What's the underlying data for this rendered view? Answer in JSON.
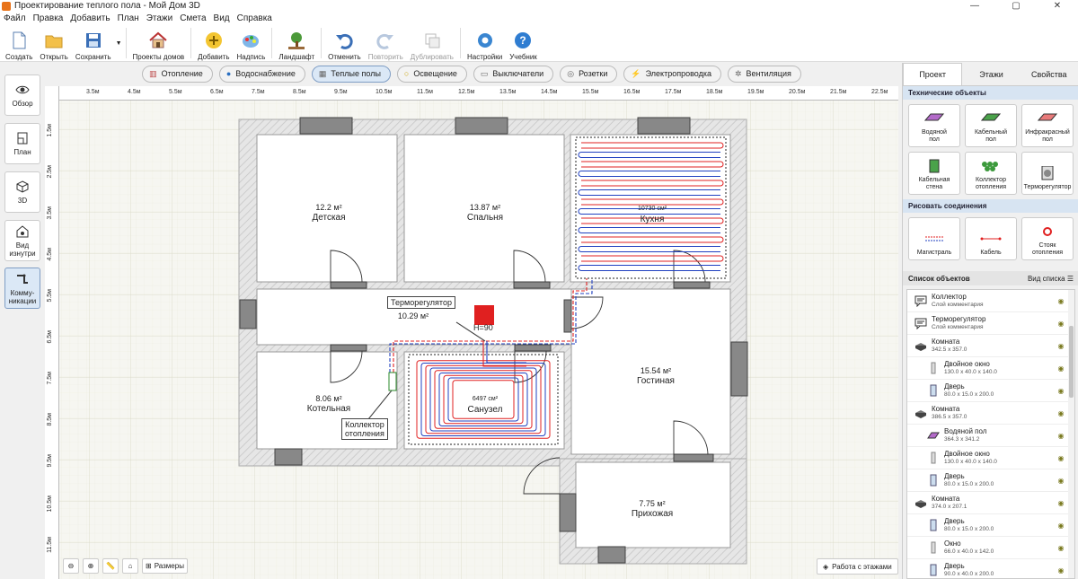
{
  "window": {
    "title": "Проектирование теплого пола - Мой Дом 3D",
    "controls": [
      "—",
      "▢",
      "✕"
    ]
  },
  "menu": [
    "Файл",
    "Правка",
    "Добавить",
    "План",
    "Этажи",
    "Смета",
    "Вид",
    "Справка"
  ],
  "toolbar": {
    "create": "Создать",
    "open": "Открыть",
    "save": "Сохранить",
    "house_projects": "Проекты домов",
    "add": "Добавить",
    "label": "Надпись",
    "landscape": "Ландшафт",
    "undo": "Отменить",
    "redo": "Повторить",
    "duplicate": "Дублировать",
    "settings": "Настройки",
    "tutorial": "Учебник"
  },
  "categories": [
    {
      "label": "Отопление",
      "icon": "radiator-icon"
    },
    {
      "label": "Водоснабжение",
      "icon": "water-drop-icon"
    },
    {
      "label": "Теплые полы",
      "icon": "floor-heating-icon",
      "active": true
    },
    {
      "label": "Освещение",
      "icon": "bulb-icon"
    },
    {
      "label": "Выключатели",
      "icon": "switch-icon"
    },
    {
      "label": "Розетки",
      "icon": "socket-icon"
    },
    {
      "label": "Электропроводка",
      "icon": "lightning-icon"
    },
    {
      "label": "Вентиляция",
      "icon": "fan-icon"
    }
  ],
  "leftbar": {
    "overview": "Обзор",
    "plan": "План",
    "view3d": "3D",
    "inside_1": "Вид",
    "inside_2": "изнутри",
    "comm_1": "Комму-",
    "comm_2": "никации"
  },
  "ruler": {
    "top": [
      "3.5м",
      "4.5м",
      "5.5м",
      "6.5м",
      "7.5м",
      "8.5м",
      "9.5м",
      "10.5м",
      "11.5м",
      "12.5м",
      "13.5м",
      "14.5м",
      "15.5м",
      "16.5м",
      "17.5м",
      "18.5м",
      "19.5м",
      "20.5м",
      "21.5м",
      "22.5м"
    ],
    "left": [
      "1.5м",
      "2.5м",
      "3.5м",
      "4.5м",
      "5.5м",
      "6.5м",
      "7.5м",
      "8.5м",
      "9.5м",
      "10.5м",
      "11.5м"
    ]
  },
  "rooms": {
    "kids": {
      "name": "Детская",
      "area": "12.2 м²"
    },
    "bedroom": {
      "name": "Спальня",
      "area": "13.87 м²"
    },
    "kitchen": {
      "name": "Кухня",
      "floor_size": "10730 см²"
    },
    "hall": {
      "area": "10.29 м²"
    },
    "boiler": {
      "name": "Котельная",
      "area": "8.06 м²"
    },
    "bathroom": {
      "name": "Санузел",
      "floor_size": "6497 см²"
    },
    "living": {
      "name": "Гостиная",
      "area": "15.54 м²"
    },
    "entry": {
      "name": "Прихожая",
      "area": "7.75 м²"
    }
  },
  "callouts": {
    "thermostat": "Терморегулятор",
    "collector_1": "Коллектор",
    "collector_2": "отопления",
    "height": "H=90"
  },
  "bottom": {
    "sizes": "Размеры",
    "floors": "Работа с этажами"
  },
  "right": {
    "tabs": [
      "Проект",
      "Этажи",
      "Свойства"
    ],
    "tech_header": "Технические объекты",
    "tech_tiles": [
      {
        "l1": "Водяной",
        "l2": "пол"
      },
      {
        "l1": "Кабельный",
        "l2": "пол"
      },
      {
        "l1": "Инфракрасный",
        "l2": "пол"
      },
      {
        "l1": "Кабельная",
        "l2": "стена"
      },
      {
        "l1": "Коллектор",
        "l2": "отопления"
      },
      {
        "l1": "Терморегулятор",
        "l2": ""
      }
    ],
    "conn_header": "Рисовать соединения",
    "conn_tiles": [
      {
        "l1": "Магистраль",
        "l2": ""
      },
      {
        "l1": "Кабель",
        "l2": ""
      },
      {
        "l1": "Стояк",
        "l2": "отопления"
      }
    ],
    "list_header": "Список объектов",
    "list_view": "Вид списка",
    "objects": [
      {
        "title": "Коллектор",
        "sub": "Слой комментария",
        "icon": "comment-icon",
        "child": false
      },
      {
        "title": "Терморегулятор",
        "sub": "Слой комментария",
        "icon": "comment-icon",
        "child": false
      },
      {
        "title": "Комната",
        "sub": "342.5 x 357.0",
        "icon": "room-icon",
        "child": false
      },
      {
        "title": "Двойное окно",
        "sub": "130.0 x 40.0 x 140.0",
        "icon": "window-icon",
        "child": true
      },
      {
        "title": "Дверь",
        "sub": "80.0 x 15.0 x 200.0",
        "icon": "door-icon",
        "child": true
      },
      {
        "title": "Комната",
        "sub": "386.5 x 357.0",
        "icon": "room-icon",
        "child": false
      },
      {
        "title": "Водяной пол",
        "sub": "364.3 x 341.2",
        "icon": "water-floor-icon",
        "child": true
      },
      {
        "title": "Двойное окно",
        "sub": "130.0 x 40.0 x 140.0",
        "icon": "window-icon",
        "child": true
      },
      {
        "title": "Дверь",
        "sub": "80.0 x 15.0 x 200.0",
        "icon": "door-icon",
        "child": true
      },
      {
        "title": "Комната",
        "sub": "374.0 x 207.1",
        "icon": "room-icon",
        "child": false
      },
      {
        "title": "Дверь",
        "sub": "80.0 x 15.0 x 200.0",
        "icon": "door-icon",
        "child": true
      },
      {
        "title": "Окно",
        "sub": "66.0 x 40.0 x 142.0",
        "icon": "window-icon",
        "child": true
      },
      {
        "title": "Дверь",
        "sub": "90.0 x 40.0 x 200.0",
        "icon": "door-icon",
        "child": true
      }
    ]
  },
  "colors": {
    "accent": "#dbe8f6",
    "pipe_hot": "#e02020",
    "pipe_cold": "#2040c0",
    "wall": "#d8d8d8"
  }
}
